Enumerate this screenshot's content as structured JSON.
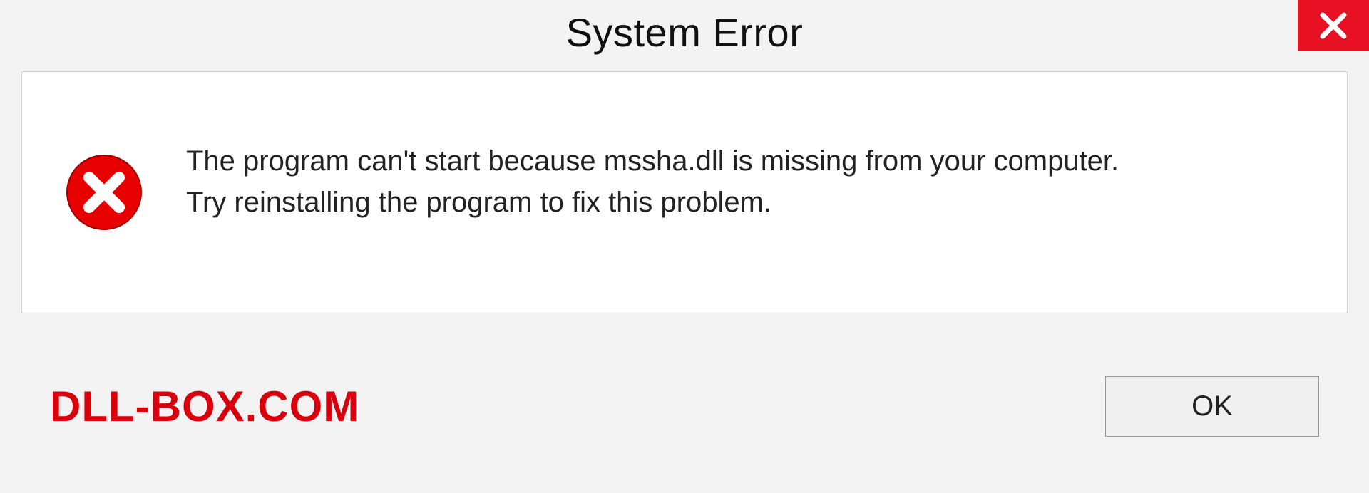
{
  "dialog": {
    "title": "System Error",
    "message_line1": "The program can't start because mssha.dll is missing from your computer.",
    "message_line2": "Try reinstalling the program to fix this problem.",
    "ok_label": "OK"
  },
  "brand": {
    "text": "DLL-BOX.COM"
  },
  "colors": {
    "close_bg": "#e81123",
    "error_red": "#d8000c"
  }
}
